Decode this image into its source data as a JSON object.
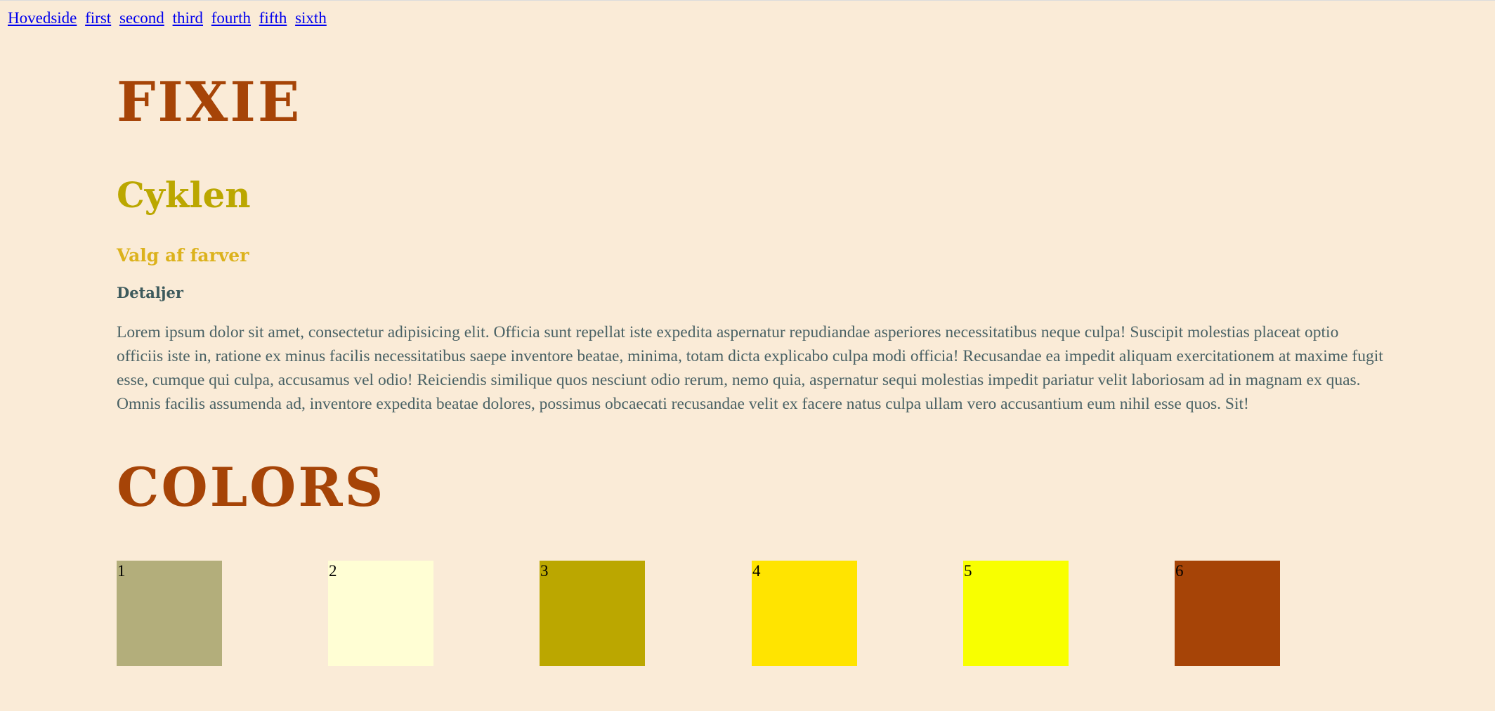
{
  "nav": {
    "links": [
      "Hovedside",
      "first",
      "second",
      "third",
      "fourth",
      "fifth",
      "sixth"
    ]
  },
  "main": {
    "title": "FIXIE",
    "subtitle": "Cyklen",
    "section_heading": "Valg af farver",
    "details_heading": "Detaljer",
    "body_text": "Lorem ipsum dolor sit amet, consectetur adipisicing elit. Officia sunt repellat iste expedita aspernatur repudiandae asperiores necessitatibus neque culpa! Suscipit molestias placeat optio officiis iste in, ratione ex minus facilis necessitatibus saepe inventore beatae, minima, totam dicta explicabo culpa modi officia! Recusandae ea impedit aliquam exercitationem at maxime fugit esse, cumque qui culpa, accusamus vel odio! Reiciendis similique quos nesciunt odio rerum, nemo quia, aspernatur sequi molestias impedit pariatur velit laboriosam ad in magnam ex quas. Omnis facilis assumenda ad, inventore expedita beatae dolores, possimus obcaecati recusandae velit ex facere natus culpa ullam vero accusantium eum nihil esse quos. Sit!",
    "colors_title": "COLORS"
  },
  "swatches": [
    {
      "label": "1",
      "color": "#b3ae7b"
    },
    {
      "label": "2",
      "color": "#fffed4"
    },
    {
      "label": "3",
      "color": "#bba700"
    },
    {
      "label": "4",
      "color": "#ffe400"
    },
    {
      "label": "5",
      "color": "#f8ff00"
    },
    {
      "label": "6",
      "color": "#a64407"
    }
  ],
  "theme": {
    "background": "#faebd7",
    "accent_rust": "#a64407",
    "accent_olive": "#bba700",
    "accent_gold": "#dcb21c",
    "text_slate": "#3d5a5c",
    "link": "#0000ee"
  }
}
